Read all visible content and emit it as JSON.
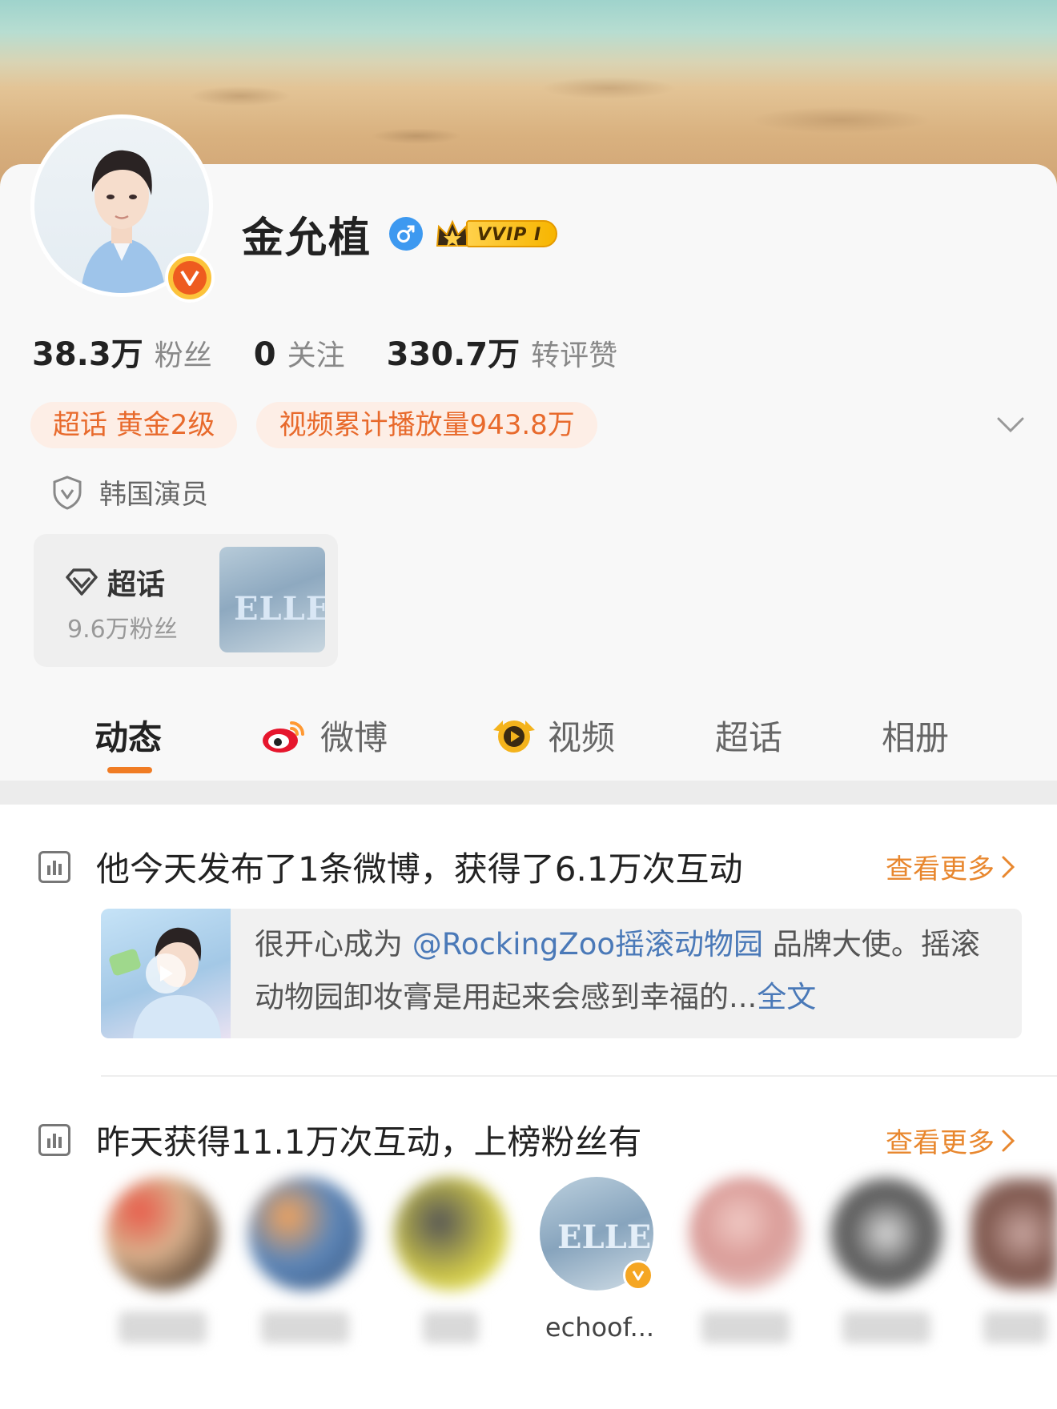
{
  "profile": {
    "name": "金允植",
    "vip_label": "VVIP I",
    "stats": [
      {
        "num": "38.3万",
        "label": "粉丝"
      },
      {
        "num": "0",
        "label": "关注"
      },
      {
        "num": "330.7万",
        "label": "转评赞"
      }
    ],
    "tags": [
      "超话 黄金2级",
      "视频累计播放量943.8万"
    ],
    "certification": "韩国演员",
    "supertopic": {
      "title": "超话",
      "fans": "9.6万粉丝",
      "thumb_text": "ELLE"
    }
  },
  "tabs": [
    {
      "label": "动态"
    },
    {
      "label": "微博"
    },
    {
      "label": "视频"
    },
    {
      "label": "超话"
    },
    {
      "label": "相册"
    }
  ],
  "feed": {
    "today": {
      "title": "他今天发布了1条微博，获得了6.1万次互动",
      "more": "查看更多",
      "post_text_start": "很开心成为",
      "post_mention": "@RockingZoo摇滚动物园",
      "post_text_end": "品牌大使。摇滚动物园卸妆膏是用起来会感到幸福的...",
      "post_full": "全文"
    },
    "yesterday": {
      "title": "昨天获得11.1万次互动，上榜粉丝有",
      "more": "查看更多",
      "visible_fan_name": "echoof...",
      "visible_fan_thumb_text": "ELLE"
    }
  },
  "colors": {
    "accent": "#f07c24",
    "link": "#4a79b8",
    "tag_text": "#e86a2c",
    "tag_bg": "#fdeee6",
    "verify_orange": "#ee5b1f",
    "gender_blue": "#3d99f0"
  }
}
